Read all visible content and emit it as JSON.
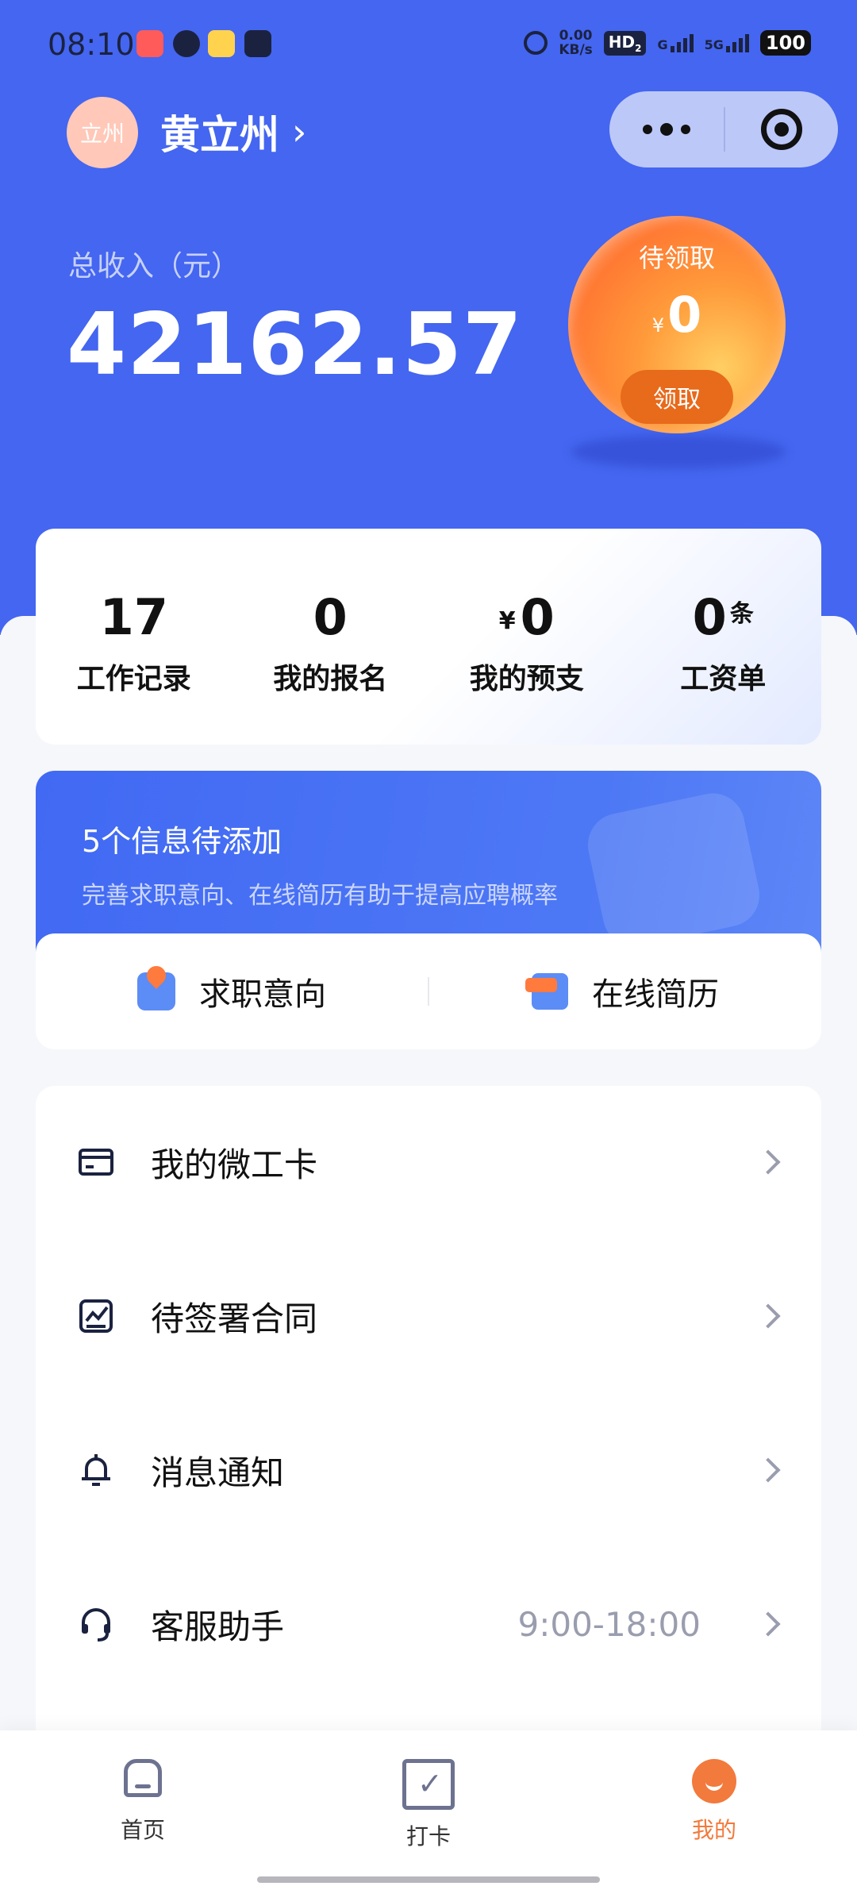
{
  "status_bar": {
    "time": "08:10",
    "net_speed_value": "0.00",
    "net_speed_unit": "KB/s",
    "hd_badge": "HD",
    "hd_sub": "2",
    "g_label": "G",
    "fiveg_label": "5G",
    "battery": "100"
  },
  "profile": {
    "avatar_text": "立州",
    "name": "黄立州",
    "chevron": "›"
  },
  "income": {
    "label": "总收入（元）",
    "value": "42162.57"
  },
  "reward": {
    "label": "待领取",
    "currency": "¥",
    "amount": "0",
    "button": "领取"
  },
  "stats": [
    {
      "prefix": "",
      "value": "17",
      "suffix": "",
      "label": "工作记录"
    },
    {
      "prefix": "",
      "value": "0",
      "suffix": "",
      "label": "我的报名"
    },
    {
      "prefix": "¥",
      "value": "0",
      "suffix": "",
      "label": "我的预支"
    },
    {
      "prefix": "",
      "value": "0",
      "suffix": "条",
      "label": "工资单"
    }
  ],
  "banner": {
    "title": "5个信息待添加",
    "subtitle": "完善求职意向、在线简历有助于提高应聘概率"
  },
  "shortcuts": [
    {
      "label": "求职意向",
      "icon": "job-intent-icon"
    },
    {
      "label": "在线简历",
      "icon": "resume-icon"
    }
  ],
  "menu": [
    {
      "label": "我的微工卡",
      "icon": "id-card-icon",
      "extra": ""
    },
    {
      "label": "待签署合同",
      "icon": "contract-sign-icon",
      "extra": ""
    },
    {
      "label": "消息通知",
      "icon": "bell-icon",
      "extra": ""
    },
    {
      "label": "客服助手",
      "icon": "headset-icon",
      "extra": "9:00-18:00"
    }
  ],
  "tabbar": {
    "active": "我的",
    "items": [
      {
        "label": "首页",
        "icon": "home-icon"
      },
      {
        "label": "打卡",
        "icon": "calendar-check-icon"
      },
      {
        "label": "我的",
        "icon": "profile-smile-icon"
      }
    ]
  },
  "colors": {
    "hero_blue": "#4466f0",
    "accent_orange": "#f27a3c",
    "text_primary": "#111111",
    "text_muted": "#9a9dae"
  }
}
